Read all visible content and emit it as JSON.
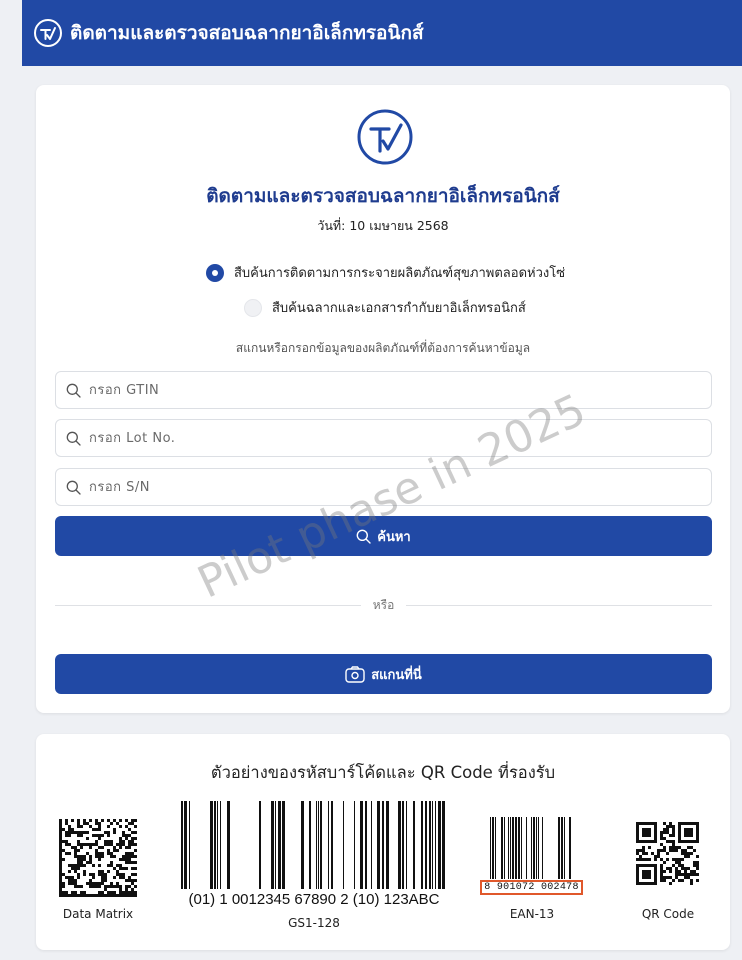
{
  "header": {
    "title": "ติดตามและตรวจสอบฉลากยาอิเล็กทรอนิกส์"
  },
  "main": {
    "title": "ติดตามและตรวจสอบฉลากยาอิเล็กทรอนิกส์",
    "date": "วันที่: 10 เมษายน 2568",
    "options": [
      {
        "label": "สืบค้นการติดตามการกระจายผลิตภัณฑ์สุขภาพตลอดห่วงโซ่",
        "selected": true
      },
      {
        "label": "สืบค้นฉลากและเอกสารกำกับยาอิเล็กทรอนิกส์",
        "selected": false
      }
    ],
    "hint": "สแกนหรือกรอกข้อมูลของผลิตภัณฑ์ที่ต้องการค้นหาข้อมูล",
    "fields": {
      "gtin_placeholder": "กรอก GTIN",
      "lot_placeholder": "กรอก Lot No.",
      "sn_placeholder": "กรอก S/N"
    },
    "search_label": "ค้นหา",
    "or_label": "หรือ",
    "scan_label": "สแกนที่นี่",
    "watermark": "Pilot phase in 2025"
  },
  "codes": {
    "title": "ตัวอย่างของรหัสบาร์โค้ดและ QR Code ที่รองรับ",
    "items": [
      {
        "label": "Data Matrix"
      },
      {
        "label": "GS1-128",
        "text": "(01) 1 0012345 67890 2 (10) 123ABC"
      },
      {
        "label": "EAN-13",
        "text": "8 901072 002478"
      },
      {
        "label": "QR Code"
      }
    ]
  },
  "colors": {
    "primary": "#2149a5",
    "highlight": "#e0582b"
  },
  "icons": [
    "tick-logo-icon",
    "search-icon",
    "camera-icon"
  ]
}
